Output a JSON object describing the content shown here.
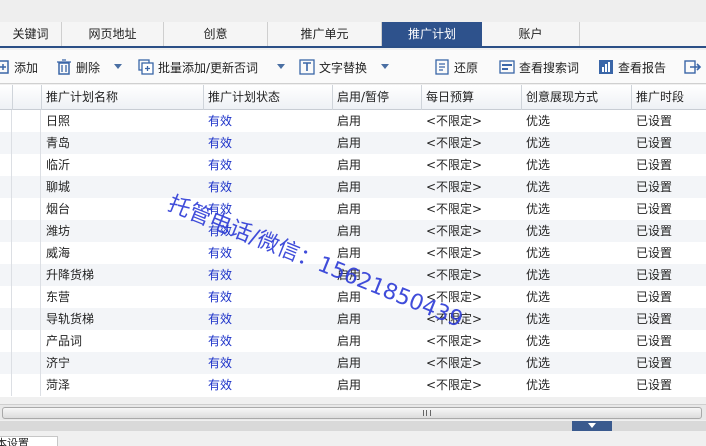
{
  "tabs": [
    {
      "label": "关键词",
      "active": false
    },
    {
      "label": "网页地址",
      "active": false
    },
    {
      "label": "创意",
      "active": false
    },
    {
      "label": "推广单元",
      "active": false
    },
    {
      "label": "推广计划",
      "active": true
    },
    {
      "label": "账户",
      "active": false
    }
  ],
  "toolbar": {
    "add": "添加",
    "delete": "删除",
    "batch_add": "批量添加/更新否词",
    "replace_text": "文字替换",
    "restore": "还原",
    "view_search_terms": "查看搜索词",
    "view_report": "查看报告"
  },
  "columns": [
    "推广计划名称",
    "推广计划状态",
    "启用/暂停",
    "每日预算",
    "创意展现方式",
    "推广时段"
  ],
  "rows": [
    {
      "name": "日照",
      "status": "有效",
      "enabled": "启用",
      "budget": "<不限定>",
      "display": "优选",
      "schedule": "已设置"
    },
    {
      "name": "青岛",
      "status": "有效",
      "enabled": "启用",
      "budget": "<不限定>",
      "display": "优选",
      "schedule": "已设置"
    },
    {
      "name": "临沂",
      "status": "有效",
      "enabled": "启用",
      "budget": "<不限定>",
      "display": "优选",
      "schedule": "已设置"
    },
    {
      "name": "聊城",
      "status": "有效",
      "enabled": "启用",
      "budget": "<不限定>",
      "display": "优选",
      "schedule": "已设置"
    },
    {
      "name": "烟台",
      "status": "有效",
      "enabled": "启用",
      "budget": "<不限定>",
      "display": "优选",
      "schedule": "已设置"
    },
    {
      "name": "潍坊",
      "status": "有效",
      "enabled": "启用",
      "budget": "<不限定>",
      "display": "优选",
      "schedule": "已设置"
    },
    {
      "name": "威海",
      "status": "有效",
      "enabled": "启用",
      "budget": "<不限定>",
      "display": "优选",
      "schedule": "已设置"
    },
    {
      "name": "升降货梯",
      "status": "有效",
      "enabled": "启用",
      "budget": "<不限定>",
      "display": "优选",
      "schedule": "已设置"
    },
    {
      "name": "东营",
      "status": "有效",
      "enabled": "启用",
      "budget": "<不限定>",
      "display": "优选",
      "schedule": "已设置"
    },
    {
      "name": "导轨货梯",
      "status": "有效",
      "enabled": "启用",
      "budget": "<不限定>",
      "display": "优选",
      "schedule": "已设置"
    },
    {
      "name": "产品词",
      "status": "有效",
      "enabled": "启用",
      "budget": "<不限定>",
      "display": "优选",
      "schedule": "已设置"
    },
    {
      "name": "济宁",
      "status": "有效",
      "enabled": "启用",
      "budget": "<不限定>",
      "display": "优选",
      "schedule": "已设置"
    },
    {
      "name": "菏泽",
      "status": "有效",
      "enabled": "启用",
      "budget": "<不限定>",
      "display": "优选",
      "schedule": "已设置"
    }
  ],
  "watermark": "托管电话/微信：15621850439",
  "bottom_tab": "基本设置",
  "colors": {
    "accent": "#2e528c",
    "status": "#1a30c8"
  }
}
